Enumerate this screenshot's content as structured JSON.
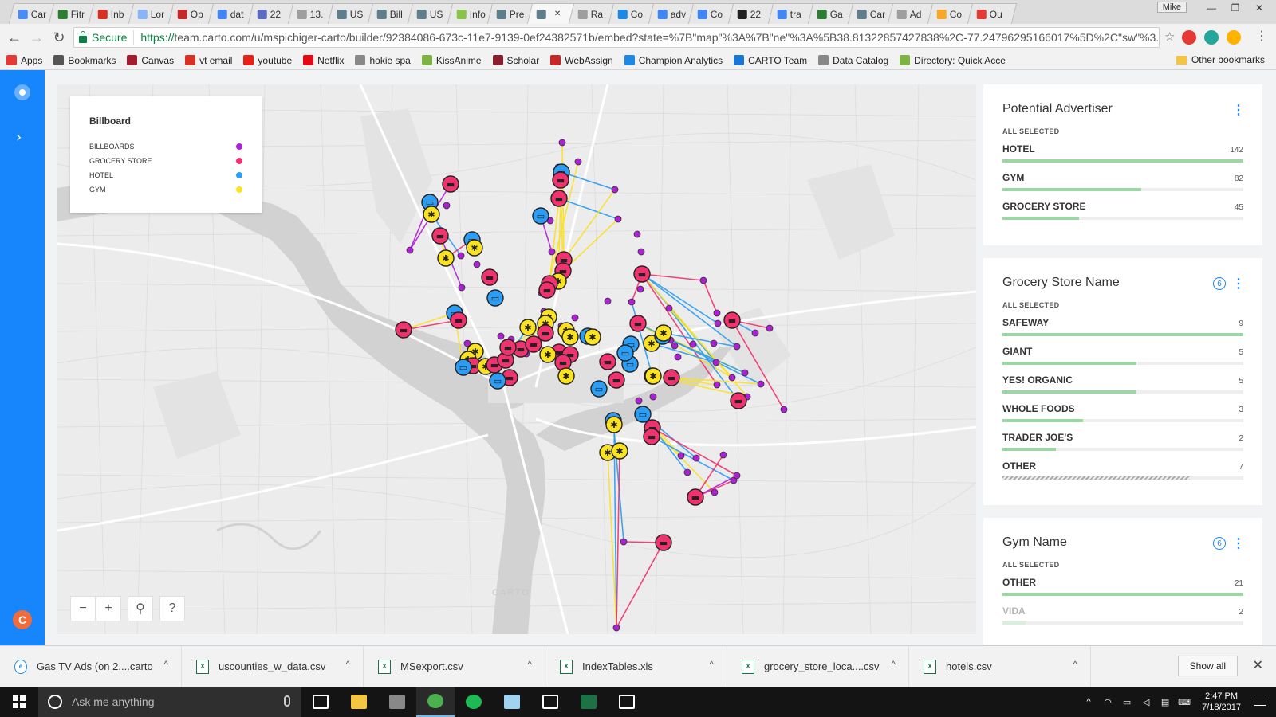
{
  "browser": {
    "tabs": [
      {
        "title": "Car",
        "color": "#4c8bf5"
      },
      {
        "title": "Fitr",
        "color": "#2e7d32"
      },
      {
        "title": "Inb",
        "color": "#d93025"
      },
      {
        "title": "Lor",
        "color": "#8ab4f8"
      },
      {
        "title": "Op",
        "color": "#c62828"
      },
      {
        "title": "dat",
        "color": "#4285f4"
      },
      {
        "title": "22",
        "color": "#5c6bc0"
      },
      {
        "title": "13.",
        "color": "#9e9e9e"
      },
      {
        "title": "US",
        "color": "#607d8b"
      },
      {
        "title": "Bill",
        "color": "#607d8b"
      },
      {
        "title": "US",
        "color": "#607d8b"
      },
      {
        "title": "Info",
        "color": "#8bc34a"
      },
      {
        "title": "Pre",
        "color": "#607d8b"
      },
      {
        "title": "",
        "color": "#607d8b",
        "active": true
      },
      {
        "title": "Ra",
        "color": "#9e9e9e"
      },
      {
        "title": "Co",
        "color": "#1e88e5"
      },
      {
        "title": "adv",
        "color": "#4285f4"
      },
      {
        "title": "Co",
        "color": "#4285f4"
      },
      {
        "title": "22",
        "color": "#222222"
      },
      {
        "title": "tra",
        "color": "#4285f4"
      },
      {
        "title": "Ga",
        "color": "#2e7d32"
      },
      {
        "title": "Car",
        "color": "#607d8b"
      },
      {
        "title": "Ad",
        "color": "#9e9e9e"
      },
      {
        "title": "Co",
        "color": "#f9a825"
      },
      {
        "title": "Ou",
        "color": "#e53935"
      }
    ],
    "user": "Mike",
    "secure_label": "Secure",
    "url_scheme": "https://",
    "url_rest": "team.carto.com/u/mspichiger-carto/builder/92384086-673c-11e7-9139-0ef24382571b/embed?state=%7B\"map\"%3A%7B\"ne\"%3A%5B38.81322857427838%2C-77.24796295166017%5D%2C\"sw\"%3...",
    "bookmarks": [
      {
        "label": "Apps",
        "color": "#e53935"
      },
      {
        "label": "Bookmarks",
        "color": "#555555"
      },
      {
        "label": "Canvas",
        "color": "#a51c30"
      },
      {
        "label": "vt email",
        "color": "#d93025"
      },
      {
        "label": "youtube",
        "color": "#e62117"
      },
      {
        "label": "Netflix",
        "color": "#e50914"
      },
      {
        "label": "hokie spa",
        "color": "#888888"
      },
      {
        "label": "KissAnime",
        "color": "#7cb342"
      },
      {
        "label": "Scholar",
        "color": "#8b1e2e"
      },
      {
        "label": "WebAssign",
        "color": "#c62828"
      },
      {
        "label": "Champion Analytics",
        "color": "#1e88e5"
      },
      {
        "label": "CARTO Team",
        "color": "#1976d2"
      },
      {
        "label": "Data Catalog",
        "color": "#888888"
      },
      {
        "label": "Directory: Quick Acce",
        "color": "#7cb342"
      }
    ],
    "other_bookmarks": "Other bookmarks"
  },
  "legend": {
    "title": "Billboard",
    "items": [
      {
        "label": "BILLBOARDS",
        "color": "#b01fd8"
      },
      {
        "label": "GROCERY STORE",
        "color": "#f2316f"
      },
      {
        "label": "HOTEL",
        "color": "#2b9df4"
      },
      {
        "label": "GYM",
        "color": "#fbe21f"
      }
    ]
  },
  "map": {
    "attribution": "CARTO",
    "controls": {
      "zoom_out": "−",
      "zoom_in": "+",
      "search": "⚲",
      "help": "?"
    }
  },
  "widgets": [
    {
      "title": "Potential Advertiser",
      "selected_label": "ALL SELECTED",
      "badge": "",
      "rows": [
        {
          "label": "HOTEL",
          "value": "142",
          "fraction": 1.0
        },
        {
          "label": "GYM",
          "value": "82",
          "fraction": 0.577
        },
        {
          "label": "GROCERY STORE",
          "value": "45",
          "fraction": 0.317
        }
      ]
    },
    {
      "title": "Grocery Store Name",
      "selected_label": "ALL SELECTED",
      "badge": "6",
      "rows": [
        {
          "label": "SAFEWAY",
          "value": "9",
          "fraction": 1.0
        },
        {
          "label": "GIANT",
          "value": "5",
          "fraction": 0.556
        },
        {
          "label": "YES! ORGANIC",
          "value": "5",
          "fraction": 0.556
        },
        {
          "label": "WHOLE FOODS",
          "value": "3",
          "fraction": 0.333
        },
        {
          "label": "TRADER JOE'S",
          "value": "2",
          "fraction": 0.222
        },
        {
          "label": "OTHER",
          "value": "7",
          "fraction": 0.778,
          "hatch": true
        }
      ]
    },
    {
      "title": "Gym Name",
      "selected_label": "ALL SELECTED",
      "badge": "6",
      "rows": [
        {
          "label": "OTHER",
          "value": "21",
          "fraction": 1.0
        },
        {
          "label": "VIDA",
          "value": "2",
          "fraction": 0.095,
          "dim": true
        }
      ]
    }
  ],
  "downloads": [
    {
      "name": "Gas TV Ads (on 2....carto",
      "kind": "ie"
    },
    {
      "name": "uscounties_w_data.csv",
      "kind": "x"
    },
    {
      "name": "MSexport.csv",
      "kind": "x"
    },
    {
      "name": "IndexTables.xls",
      "kind": "x"
    },
    {
      "name": "grocery_store_loca....csv",
      "kind": "x"
    },
    {
      "name": "hotels.csv",
      "kind": "x"
    }
  ],
  "downloads_show_all": "Show all",
  "taskbar": {
    "search_placeholder": "Ask me anything",
    "time": "2:47 PM",
    "date": "7/18/2017",
    "apps": [
      {
        "name": "task-view",
        "color": "#ffffff"
      },
      {
        "name": "file-explorer",
        "color": "#f4c542"
      },
      {
        "name": "pen-app",
        "color": "#888888"
      },
      {
        "name": "chrome",
        "color": "#4caf50",
        "active": true
      },
      {
        "name": "spotify",
        "color": "#1db954"
      },
      {
        "name": "notepad-app",
        "color": "#9fd3f0"
      },
      {
        "name": "mail",
        "color": "#ffffff"
      },
      {
        "name": "excel",
        "color": "#1e7145"
      },
      {
        "name": "slack",
        "color": "#ffffff"
      }
    ]
  }
}
